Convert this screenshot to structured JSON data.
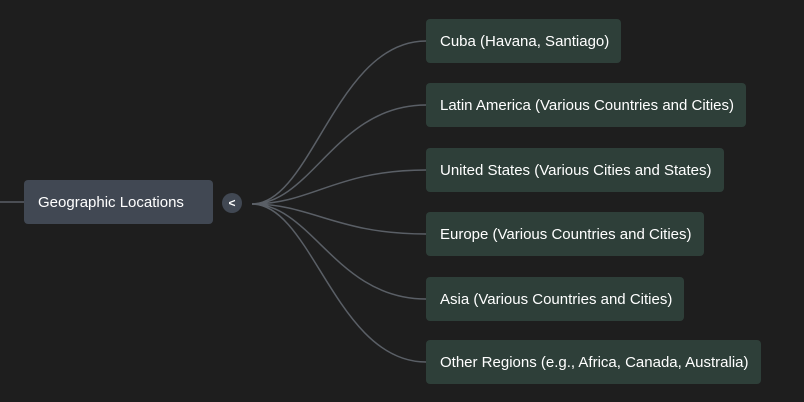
{
  "root": {
    "label": "Geographic Locations",
    "toggle_symbol": "<"
  },
  "children": [
    {
      "label": "Cuba (Havana, Santiago)"
    },
    {
      "label": "Latin America (Various Countries and Cities)"
    },
    {
      "label": "United States (Various Cities and States)"
    },
    {
      "label": "Europe (Various Countries and Cities)"
    },
    {
      "label": "Asia (Various Countries and Cities)"
    },
    {
      "label": "Other Regions (e.g., Africa, Canada, Australia)"
    }
  ],
  "colors": {
    "background": "#1e1e1e",
    "root_node": "#414853",
    "child_node": "#2e3f39",
    "edge": "#5a5f66",
    "text": "#ffffff"
  }
}
